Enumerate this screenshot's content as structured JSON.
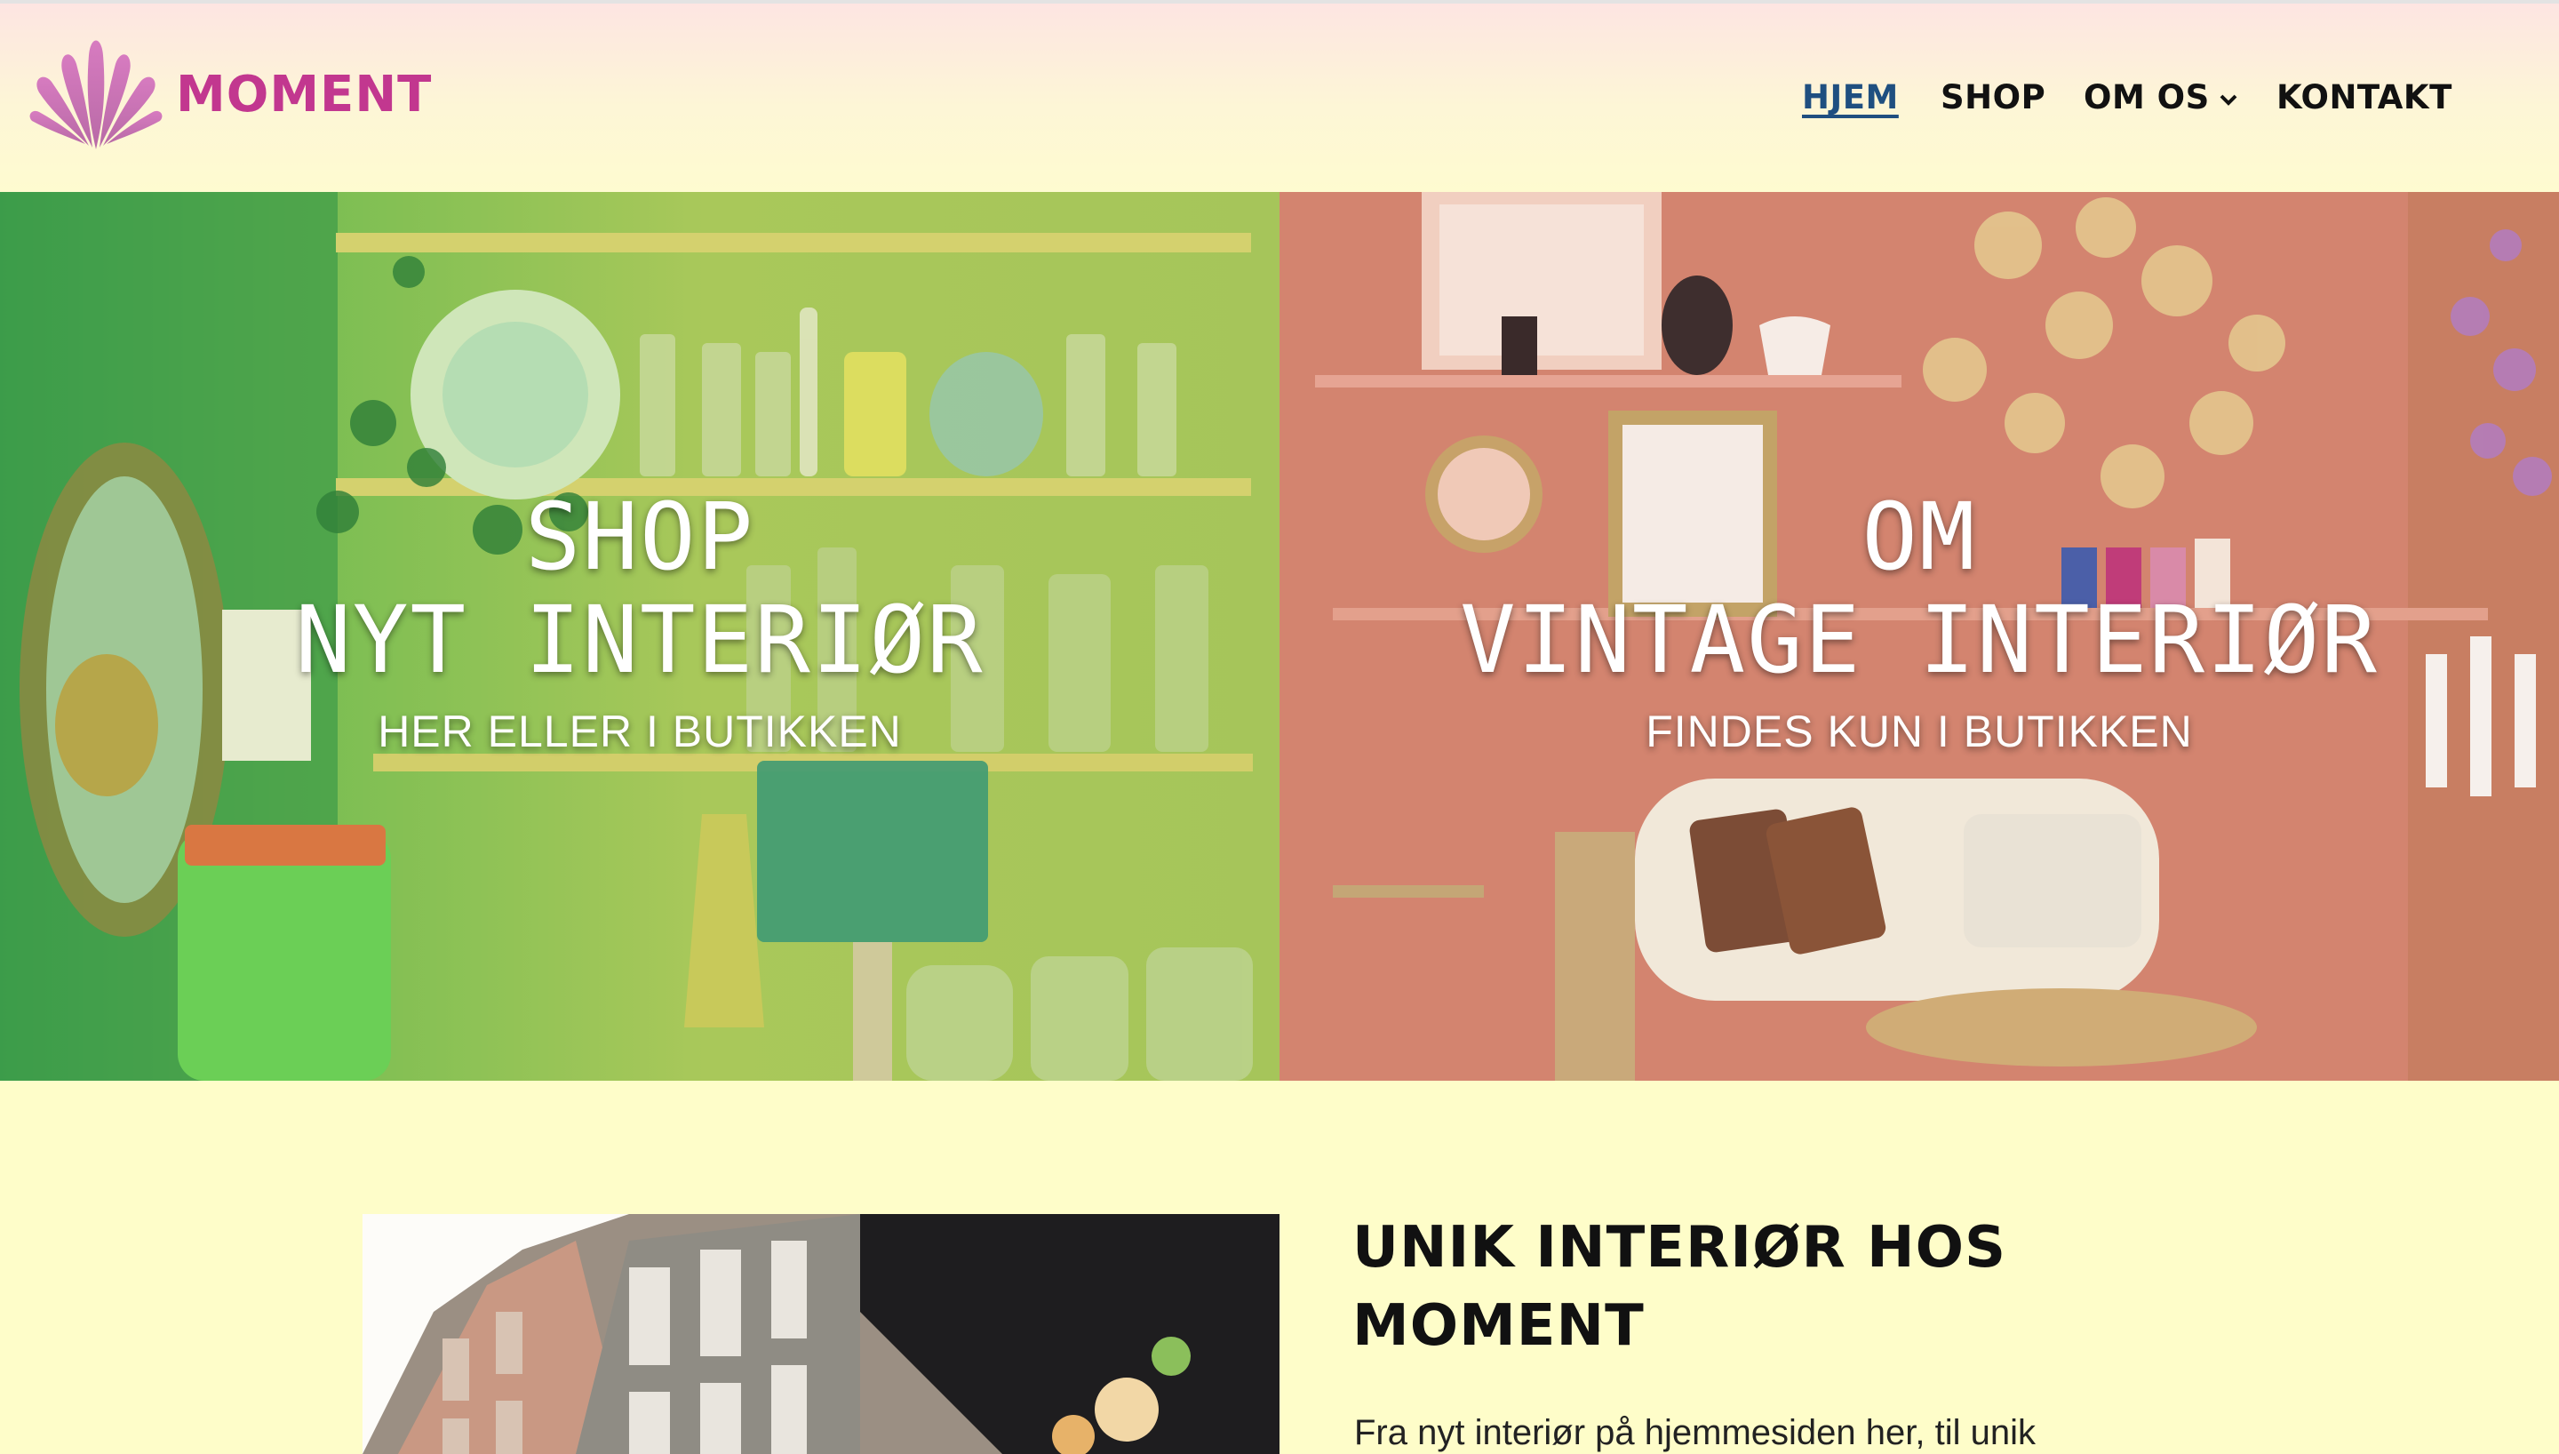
{
  "site": {
    "logo_text": "MOMENT"
  },
  "nav": {
    "items": [
      {
        "label": "HJEM",
        "active": true
      },
      {
        "label": "SHOP",
        "active": false
      },
      {
        "label": "OM OS",
        "active": false,
        "has_dropdown": true
      },
      {
        "label": "KONTAKT",
        "active": false
      }
    ]
  },
  "hero": {
    "left": {
      "title_line1": "SHOP",
      "title_line2": "NYT INTERIØR",
      "subtitle": "HER ELLER I BUTIKKEN"
    },
    "right": {
      "title_line1": "OM",
      "title_line2": "VINTAGE INTERIØR",
      "subtitle": "FINDES KUN I BUTIKKEN"
    }
  },
  "about": {
    "heading_line1": "UNIK INTERIØR HOS",
    "heading_line2": "MOMENT",
    "text": "Fra nyt interiør på hjemmesiden her, til unik"
  },
  "colors": {
    "brand": "#c2378f",
    "nav_active": "#1f4f80",
    "background": "#fefdc9"
  },
  "icons": {
    "logo": "shell-icon",
    "dropdown": "chevron-down-icon"
  }
}
